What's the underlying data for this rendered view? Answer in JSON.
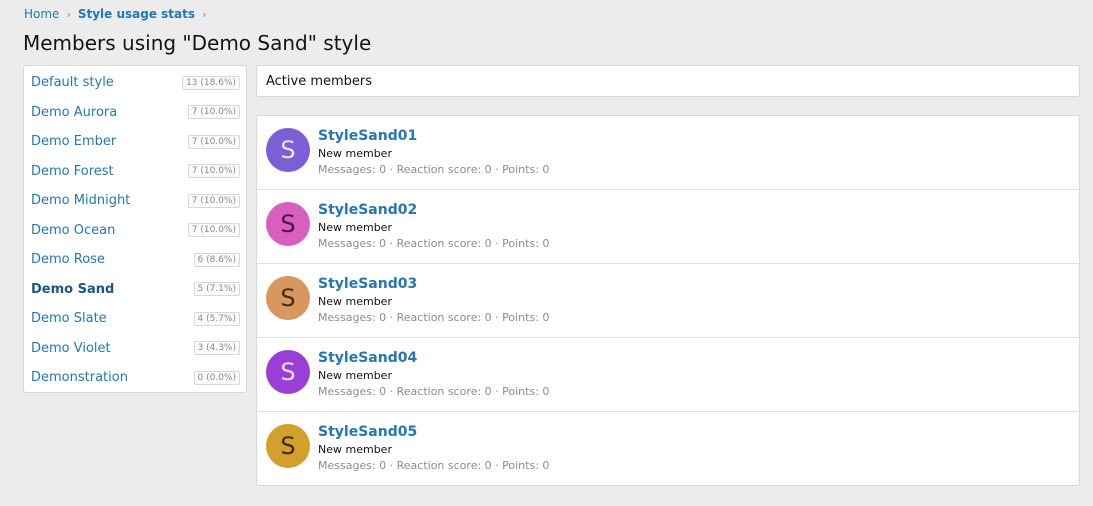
{
  "breadcrumb": {
    "home": "Home",
    "section": "Style usage stats",
    "sep_glyph": "›"
  },
  "page_title": "Members using \"Demo Sand\" style",
  "sidebar": {
    "items": [
      {
        "label": "Default style",
        "count": "13 (18.6%)",
        "active": false
      },
      {
        "label": "Demo Aurora",
        "count": "7 (10.0%)",
        "active": false
      },
      {
        "label": "Demo Ember",
        "count": "7 (10.0%)",
        "active": false
      },
      {
        "label": "Demo Forest",
        "count": "7 (10.0%)",
        "active": false
      },
      {
        "label": "Demo Midnight",
        "count": "7 (10.0%)",
        "active": false
      },
      {
        "label": "Demo Ocean",
        "count": "7 (10.0%)",
        "active": false
      },
      {
        "label": "Demo Rose",
        "count": "6 (8.6%)",
        "active": false
      },
      {
        "label": "Demo Sand",
        "count": "5 (7.1%)",
        "active": true
      },
      {
        "label": "Demo Slate",
        "count": "4 (5.7%)",
        "active": false
      },
      {
        "label": "Demo Violet",
        "count": "3 (4.3%)",
        "active": false
      },
      {
        "label": "Demonstration",
        "count": "0 (0.0%)",
        "active": false
      }
    ]
  },
  "tab": {
    "label": "Active members"
  },
  "members": [
    {
      "initial": "S",
      "name": "StyleSand01",
      "title": "New member",
      "stats": "Messages: 0 · Reaction score: 0 · Points: 0",
      "avatar_bg": "#7b5fd6",
      "avatar_fg": "#e9e3fb"
    },
    {
      "initial": "S",
      "name": "StyleSand02",
      "title": "New member",
      "stats": "Messages: 0 · Reaction score: 0 · Points: 0",
      "avatar_bg": "#d75fbe",
      "avatar_fg": "#4d1442"
    },
    {
      "initial": "S",
      "name": "StyleSand03",
      "title": "New member",
      "stats": "Messages: 0 · Reaction score: 0 · Points: 0",
      "avatar_bg": "#d7975f",
      "avatar_fg": "#4d2a0e"
    },
    {
      "initial": "S",
      "name": "StyleSand04",
      "title": "New member",
      "stats": "Messages: 0 · Reaction score: 0 · Points: 0",
      "avatar_bg": "#9a3fd6",
      "avatar_fg": "#ecdcf9"
    },
    {
      "initial": "S",
      "name": "StyleSand05",
      "title": "New member",
      "stats": "Messages: 0 · Reaction score: 0 · Points: 0",
      "avatar_bg": "#d3a02e",
      "avatar_fg": "#3d2b04"
    }
  ],
  "colors": {
    "link": "#2577b1",
    "active_link": "#185886",
    "background": "#ececec",
    "muted": "#8c8c8c"
  }
}
